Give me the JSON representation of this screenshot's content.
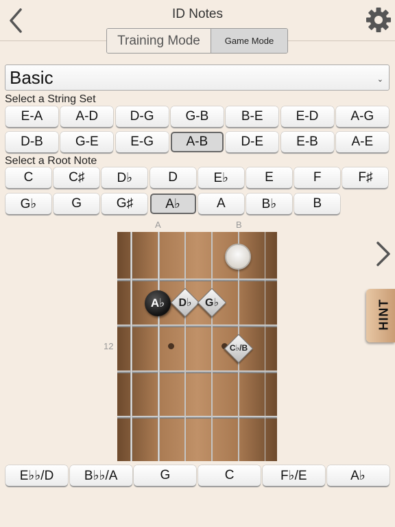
{
  "header": {
    "title": "ID Notes",
    "back_icon": "chevron-left-icon",
    "settings_icon": "gear-icon"
  },
  "mode": {
    "training_label": "Training Mode",
    "game_label": "Game Mode",
    "selected": "Game Mode"
  },
  "dropdown": {
    "value": "Basic",
    "chevron": "⌄"
  },
  "string_sets": {
    "label": "Select a String Set",
    "row1": [
      "E-A",
      "A-D",
      "D-G",
      "G-B",
      "B-E",
      "E-D",
      "A-G"
    ],
    "row2": [
      "D-B",
      "G-E",
      "E-G",
      "A-B",
      "D-E",
      "E-B",
      "A-E"
    ],
    "selected": "A-B"
  },
  "root_notes": {
    "label": "Select a Root Note",
    "row1": [
      "C",
      "C♯",
      "D♭",
      "D",
      "E♭",
      "E",
      "F",
      "F♯"
    ],
    "row2": [
      "G♭",
      "G",
      "G♯",
      "A♭",
      "A",
      "B♭",
      "B"
    ],
    "selected": "A♭"
  },
  "fretboard": {
    "string_labels": [
      "A",
      "B"
    ],
    "fret_number": "12",
    "root_marker": "A♭",
    "note_markers": [
      "D♭",
      "G♭",
      "C♭/B"
    ],
    "open_marker": ""
  },
  "answers": [
    "E♭♭/D",
    "B♭♭/A",
    "G",
    "C",
    "F♭/E",
    "A♭"
  ],
  "hint_label": "HINT",
  "colors": {
    "background": "#f5ece2",
    "hint": "#d8b08a",
    "fretboard": "#a97a52"
  }
}
